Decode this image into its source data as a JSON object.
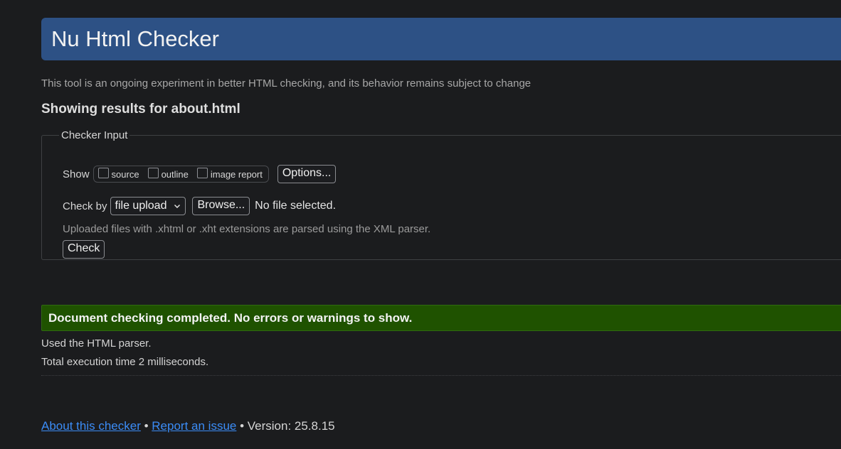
{
  "header": {
    "title": "Nu Html Checker"
  },
  "subtitle": "This tool is an ongoing experiment in better HTML checking, and its behavior remains subject to change",
  "results_heading": "Showing results for about.html",
  "checker_input": {
    "legend": "Checker Input",
    "show_label": "Show",
    "show_options": [
      {
        "label": "source",
        "checked": false
      },
      {
        "label": "outline",
        "checked": false
      },
      {
        "label": "image report",
        "checked": false
      }
    ],
    "options_button": "Options...",
    "check_by_label": "Check by",
    "check_by_selected": "file upload",
    "browse_button": "Browse...",
    "file_status": "No file selected.",
    "hint": "Uploaded files with .xhtml or .xht extensions are parsed using the XML parser.",
    "check_button": "Check"
  },
  "result": {
    "message": "Document checking completed. No errors or warnings to show.",
    "parser_info": "Used the HTML parser.",
    "execution_time": "Total execution time 2 milliseconds."
  },
  "footer": {
    "about_link": "About this checker",
    "separator": "•",
    "report_link": "Report an issue",
    "version_text": "• Version: 25.8.15"
  },
  "colors": {
    "header_bg": "#2d5185",
    "success_bg": "#1f5200",
    "link": "#3b8cf6",
    "page_bg": "#1b1c1e"
  }
}
